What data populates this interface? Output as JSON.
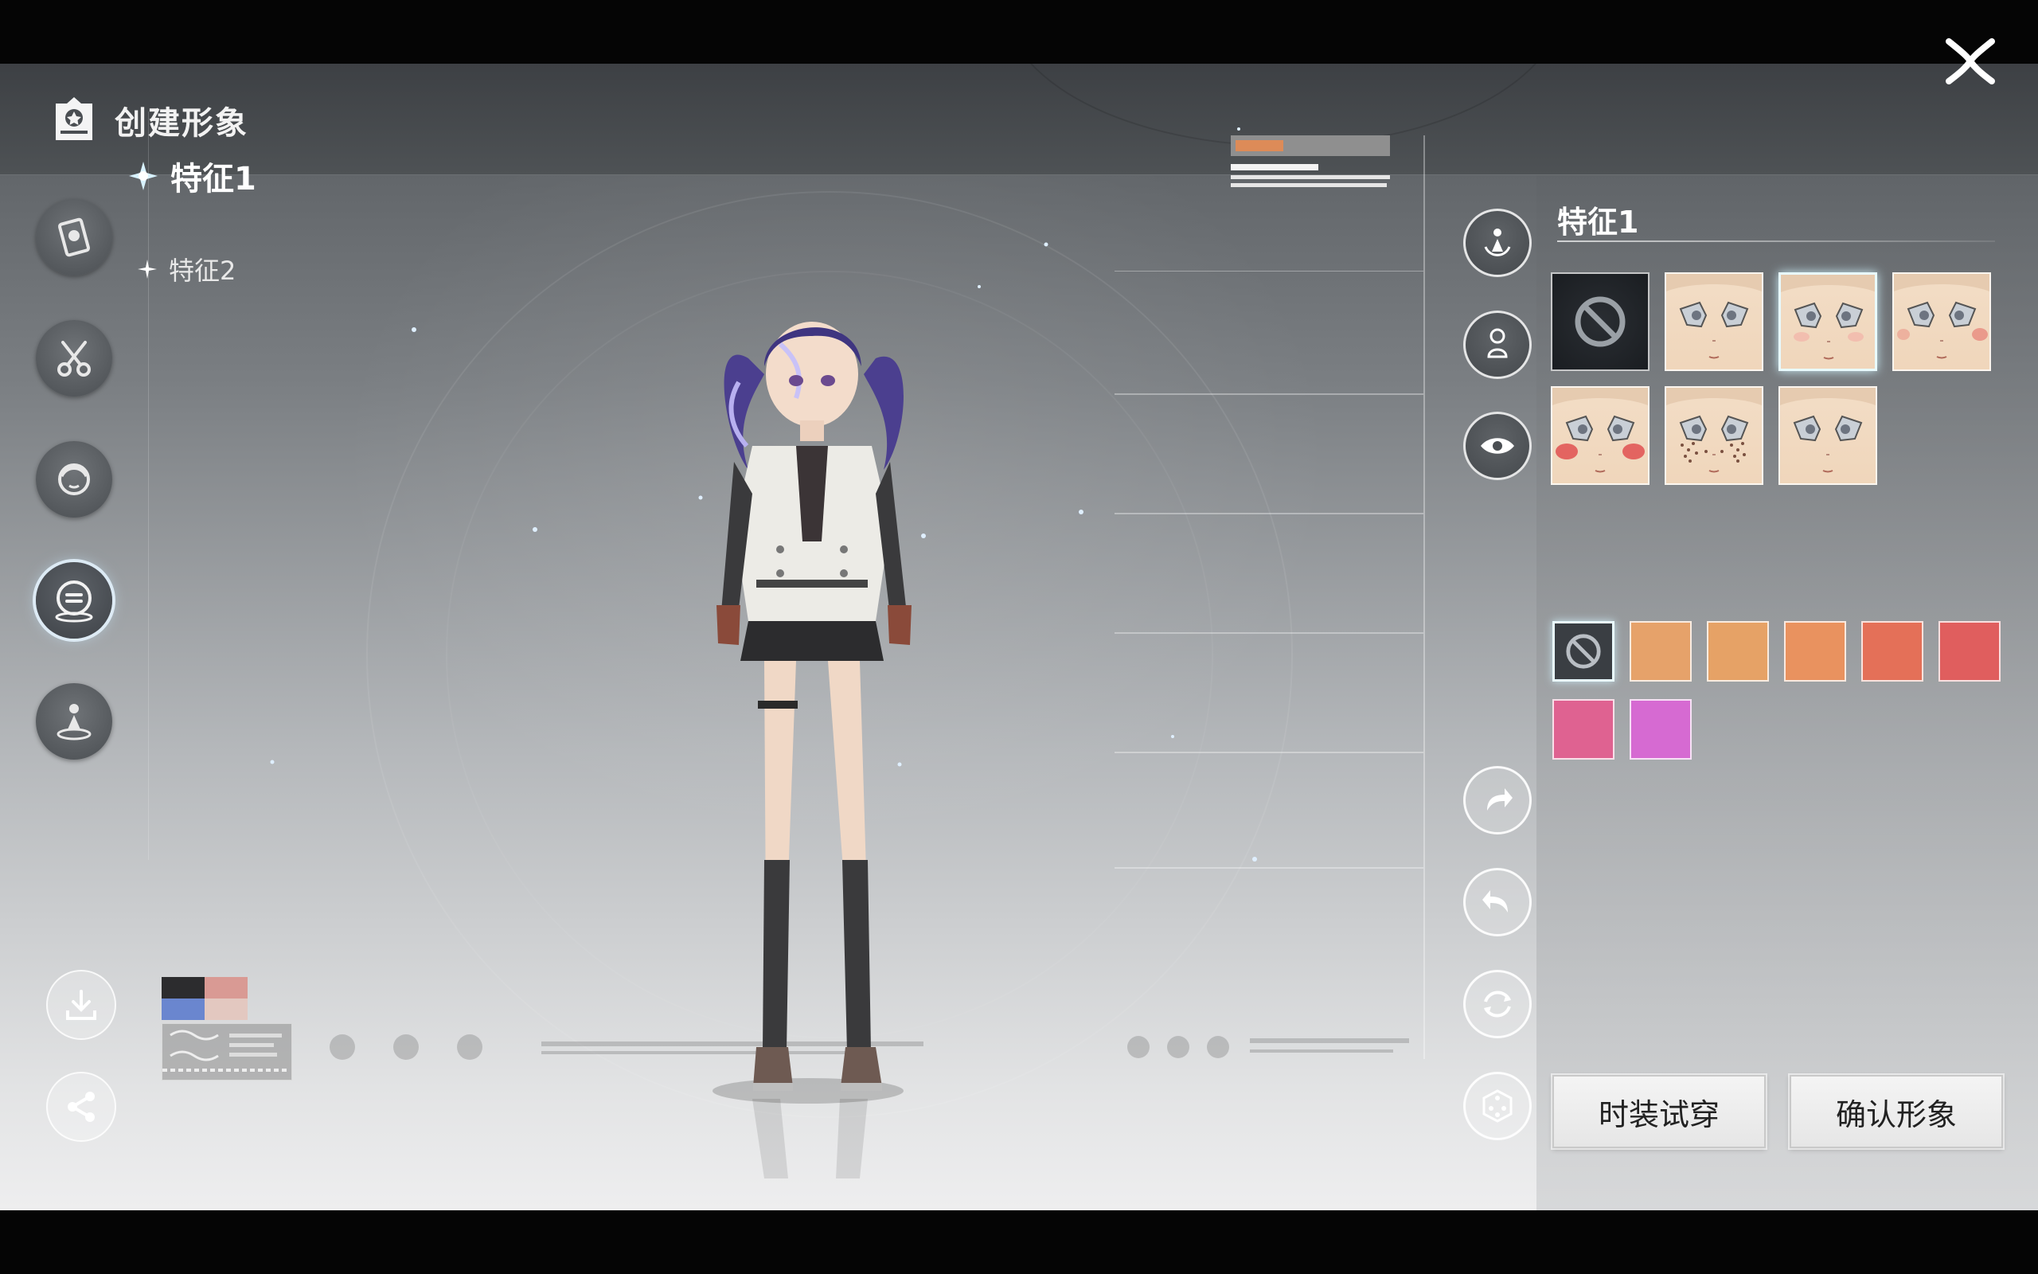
{
  "header": {
    "title": "创建形象"
  },
  "tabs": [
    {
      "label": "特征1",
      "active": true
    },
    {
      "label": "特征2",
      "active": false
    }
  ],
  "side_nav_icons": [
    "identity-card-icon",
    "hair-scissors-icon",
    "face-icon",
    "makeup-icon",
    "pose-icon"
  ],
  "side_nav_active_index": 3,
  "bottom_left_icons": [
    "download-icon",
    "share-icon"
  ],
  "tool_icons": [
    "camera-rotate-icon",
    "body-icon",
    "eye-icon",
    "redo-icon",
    "undo-icon",
    "reset-icon",
    "random-dice-icon"
  ],
  "panel": {
    "title": "特征1",
    "face_options": [
      {
        "kind": "none"
      },
      {
        "kind": "face",
        "mark": "plain"
      },
      {
        "kind": "face",
        "mark": "light-blush",
        "selected": true
      },
      {
        "kind": "face",
        "mark": "side-blush"
      },
      {
        "kind": "face",
        "mark": "strong-blush"
      },
      {
        "kind": "face",
        "mark": "freckles"
      },
      {
        "kind": "face",
        "mark": "plain"
      }
    ],
    "colors": [
      "none",
      "#e6a26a",
      "#e6a266",
      "#e9925f",
      "#e47058",
      "#e05e5e",
      "#df6291",
      "#d66ad2"
    ]
  },
  "preview_swatches": [
    "#2c2c2e",
    "#d99a94",
    "#6a86cf",
    "#e3c8c0"
  ],
  "buttons": {
    "try_on": "时装试穿",
    "confirm": "确认形象"
  },
  "colors": {
    "accent_glow": "#e9fbff",
    "button_bg": "#f0f0f0"
  }
}
